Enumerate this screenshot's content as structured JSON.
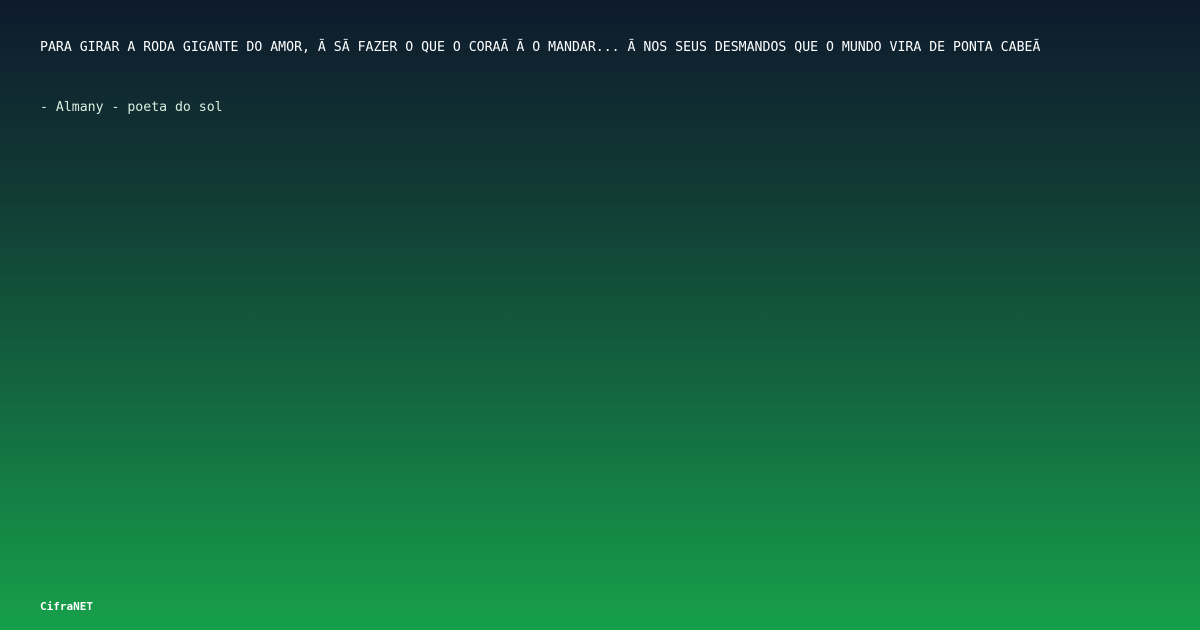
{
  "quote": {
    "text": "PARA GIRAR A RODA GIGANTE DO AMOR, Ã SÃ FAZER O QUE O CORAÃ Ã O MANDAR... Ã NOS SEUS DESMANDOS QUE O MUNDO VIRA DE PONTA CABEÃ"
  },
  "author": {
    "text": "- Almany - poeta do sol"
  },
  "brand": {
    "name": "CifraNET"
  },
  "colors": {
    "gradient_top": "#0e1a2d",
    "gradient_bottom": "#16a04a",
    "text": "#ffffff"
  }
}
